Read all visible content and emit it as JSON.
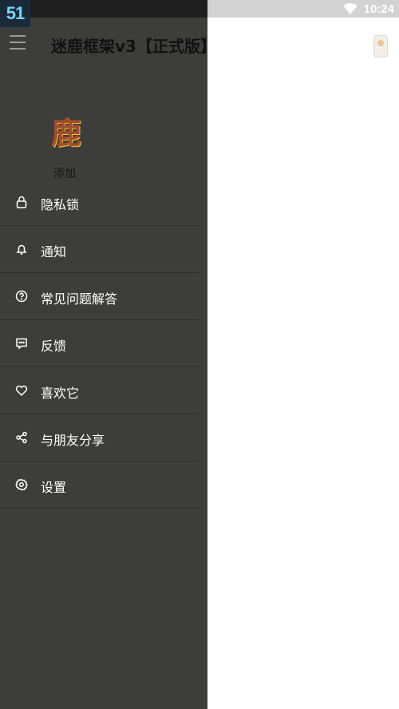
{
  "status": {
    "time": "10:24",
    "badge": "51"
  },
  "appbar": {
    "title": "迷鹿框架v3【正式版】"
  },
  "drawer": {
    "logo_glyph": "鹿",
    "add_label": "添加",
    "items": [
      {
        "label": "隐私锁",
        "icon": "lock-icon"
      },
      {
        "label": "通知",
        "icon": "bell-icon"
      },
      {
        "label": "常见问题解答",
        "icon": "help-icon"
      },
      {
        "label": "反馈",
        "icon": "chat-icon"
      },
      {
        "label": "喜欢它",
        "icon": "heart-icon"
      },
      {
        "label": "与朋友分享",
        "icon": "share-icon"
      },
      {
        "label": "设置",
        "icon": "gear-icon"
      }
    ]
  },
  "colors": {
    "drawer_bg": "#3d3e3c",
    "text": "#ffffff"
  }
}
